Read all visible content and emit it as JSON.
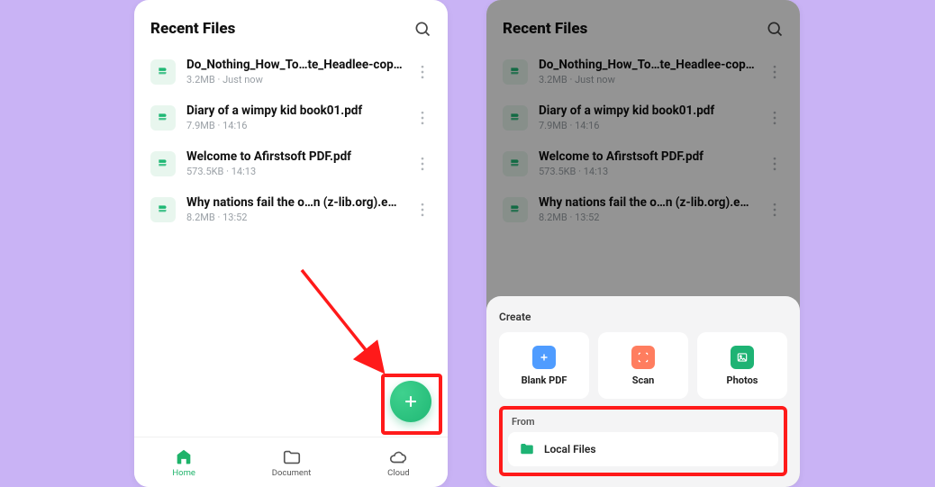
{
  "header": {
    "title": "Recent Files"
  },
  "files": [
    {
      "title": "Do_Nothing_How_To…te_Headlee-copy.pdf",
      "size": "3.2MB",
      "time": "Just now"
    },
    {
      "title": "Diary of a wimpy kid book01.pdf",
      "size": "7.9MB",
      "time": "14:16"
    },
    {
      "title": "Welcome to Afirstsoft PDF.pdf",
      "size": "573.5KB",
      "time": "14:13"
    },
    {
      "title": "Why nations fail the o…n (z-lib.org).epub.pdf",
      "size": "8.2MB",
      "time": "13:52"
    }
  ],
  "nav": {
    "home": "Home",
    "document": "Document",
    "cloud": "Cloud"
  },
  "sheet": {
    "create_label": "Create",
    "blank": "Blank PDF",
    "scan": "Scan",
    "photos": "Photos",
    "from_label": "From",
    "local_files": "Local Files"
  },
  "meta_sep": " · "
}
